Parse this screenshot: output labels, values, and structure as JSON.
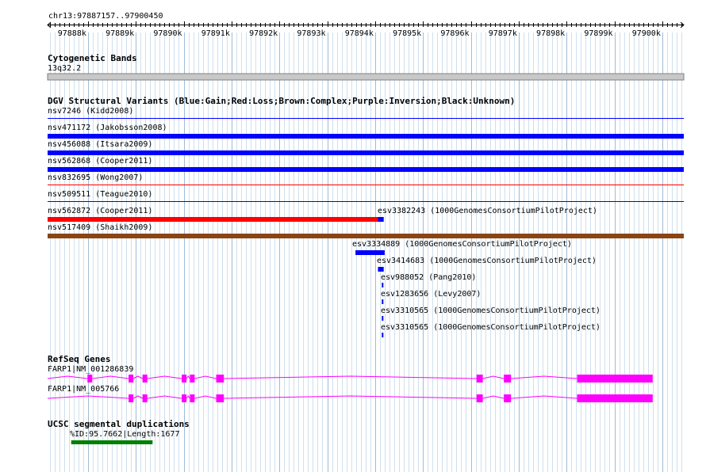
{
  "region": {
    "label": "chr13:97887157..97900450",
    "start": 97887157,
    "end": 97900450,
    "ticks": [
      "97888k",
      "97889k",
      "97890k",
      "97891k",
      "97892k",
      "97893k",
      "97894k",
      "97895k",
      "97896k",
      "97897k",
      "97898k",
      "97899k",
      "97900k"
    ]
  },
  "tracks": {
    "cytobands": {
      "title": "Cytogenetic Bands",
      "band": "13q32.2"
    },
    "dgv": {
      "title": "DGV Structural Variants (Blue:Gain;Red:Loss;Brown:Complex;Purple:Inversion;Black:Unknown)",
      "colors": {
        "gain": "#0000ff",
        "loss": "#ff0000",
        "complex": "#8b4513"
      },
      "features": [
        {
          "label": "nsv7246 (Kidd2008)",
          "type": "gain",
          "start": 97887157,
          "end": 97900450,
          "style": "thin"
        },
        {
          "label": "nsv471172 (Jakobsson2008)",
          "type": "gain",
          "start": 97887157,
          "end": 97900450,
          "style": "thick"
        },
        {
          "label": "nsv456088 (Itsara2009)",
          "type": "gain",
          "start": 97887157,
          "end": 97900450,
          "style": "thick"
        },
        {
          "label": "nsv562868 (Cooper2011)",
          "type": "gain",
          "start": 97887157,
          "end": 97900450,
          "style": "thick"
        },
        {
          "label": "nsv832695 (Wong2007)",
          "type": "loss",
          "start": 97887157,
          "end": 97900450,
          "style": "thin"
        },
        {
          "label": "nsv509511 (Teague2010)",
          "type": "gain",
          "start": 97887157,
          "end": 97900450,
          "style": "thin"
        },
        {
          "label": "nsv562872 (Cooper2011)",
          "type": "loss",
          "start": 97887157,
          "end": 97894070,
          "style": "thick"
        },
        {
          "label": "esv3382243 (1000GenomesConsortiumPilotProject)",
          "type": "gain",
          "start": 97894060,
          "end": 97894180,
          "style": "thick"
        },
        {
          "label": "nsv517409 (Shaikh2009)",
          "type": "complex",
          "start": 97887157,
          "end": 97900450,
          "style": "thick"
        },
        {
          "label": "esv3334889 (1000GenomesConsortiumPilotProject)",
          "type": "gain",
          "start": 97893590,
          "end": 97894200,
          "style": "thick"
        },
        {
          "label": "esv3414683 (1000GenomesConsortiumPilotProject)",
          "type": "gain",
          "start": 97894060,
          "end": 97894180,
          "style": "thick"
        },
        {
          "label": "esv988052 (Pang2010)",
          "type": "gain",
          "start": 97894140,
          "end": 97894180,
          "style": "tick"
        },
        {
          "label": "esv1283656 (Levy2007)",
          "type": "gain",
          "start": 97894140,
          "end": 97894180,
          "style": "tick"
        },
        {
          "label": "esv3310565 (1000GenomesConsortiumPilotProject)",
          "type": "gain",
          "start": 97894140,
          "end": 97894180,
          "style": "tick"
        },
        {
          "label": "esv3310565 (1000GenomesConsortiumPilotProject)",
          "type": "gain",
          "start": 97894140,
          "end": 97894180,
          "style": "tick"
        }
      ]
    },
    "refseq": {
      "title": "RefSeq Genes",
      "color": "#ff00ff",
      "genes": [
        {
          "label": "FARP1|NM_001286839",
          "start": 97887157,
          "end": 97900450,
          "exons": [
            [
              97887990,
              97888090
            ],
            [
              97888850,
              97888950
            ],
            [
              97889140,
              97889240
            ],
            [
              97889960,
              97890060
            ],
            [
              97890130,
              97890230
            ],
            [
              97890680,
              97890840
            ],
            [
              97896120,
              97896250
            ],
            [
              97896690,
              97896840
            ],
            [
              97898220,
              97899800
            ]
          ]
        },
        {
          "label": "FARP1|NM_005766",
          "start": 97887157,
          "end": 97900450,
          "exons": [
            [
              97888850,
              97888950
            ],
            [
              97889140,
              97889240
            ],
            [
              97889960,
              97890060
            ],
            [
              97890130,
              97890230
            ],
            [
              97890680,
              97890840
            ],
            [
              97896120,
              97896250
            ],
            [
              97896690,
              97896840
            ],
            [
              97898220,
              97899800
            ]
          ]
        }
      ]
    },
    "segdups": {
      "title": "UCSC segmental duplications",
      "color": "#008000",
      "features": [
        {
          "label": "%ID:95.7662|Length:1677",
          "start": 97887650,
          "end": 97889350
        }
      ]
    }
  }
}
